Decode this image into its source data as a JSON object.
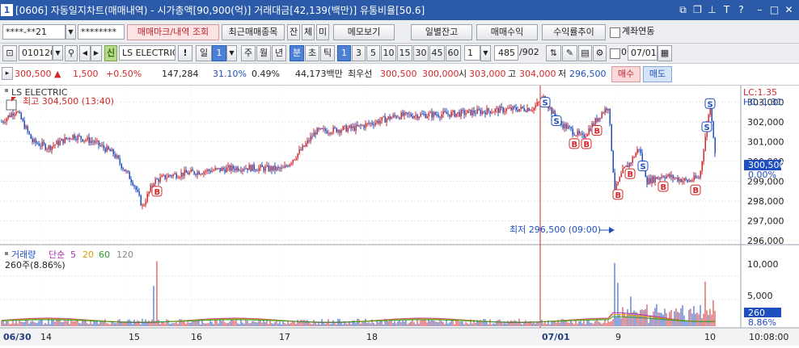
{
  "window": {
    "num": "1",
    "title": "[0606] 자동일지차트(매매내역) - 시가총액[90,900(억)] 거래대금[42,139(백만)] 유통비율[50.6]"
  },
  "toolbar1": {
    "account": "****-**21",
    "password": "********",
    "btn_trade_mark": "매매마크/내역 조회",
    "btn_recent": "최근매매종목",
    "btn_jan": "잔",
    "btn_che": "체",
    "btn_mi": "미",
    "btn_memo": "메모보기",
    "btn_daily": "일별잔고",
    "btn_profit": "매매수익",
    "btn_return": "수익률추이",
    "link_account": "계좌연동"
  },
  "toolbar2": {
    "code": "010120",
    "badge": "신",
    "name": "LS ELECTRIC",
    "excl": "!",
    "period_il": "일",
    "period_val": "1",
    "periods": [
      "주",
      "월",
      "년"
    ],
    "bun": "분",
    "cho": "초",
    "tik": "틱",
    "mins": [
      "1",
      "3",
      "5",
      "10",
      "15",
      "30",
      "45",
      "60"
    ],
    "count": "1",
    "total": "485",
    "total_max": "/902",
    "check_val": "0",
    "date": "07/01"
  },
  "quote": {
    "price": "300,500",
    "change": "1,500",
    "pct": "+0.50%",
    "volume": "147,284",
    "vol_pct": "31.10%",
    "rate": "0.49%",
    "amount": "44,173백만",
    "best_label": "최우선",
    "ask": "300,500",
    "bid": "300,000",
    "open_label": "시",
    "open": "303,000",
    "high_label": "고",
    "high": "304,000",
    "low_label": "저",
    "low": "296,500",
    "buy": "매수",
    "sell": "매도"
  },
  "price_chart": {
    "name": "LS ELECTRIC",
    "high_note": "최고 304,500 (13:40)",
    "low_note": "최저 296,500 (09:00)",
    "lc": "LC:1.35",
    "hc": "HC:-1.31",
    "current": "300,500",
    "current_pct": "0.00%",
    "y_labels": [
      "303,000",
      "302,000",
      "301,000",
      "300,000",
      "299,000",
      "298,000",
      "297,000",
      "296,000"
    ]
  },
  "volume_chart": {
    "title": "거래량",
    "ma_label": "단순",
    "ma": [
      "5",
      "20",
      "60",
      "120"
    ],
    "current": "260주(8.86%)",
    "y_labels": [
      "10,000",
      "5,000"
    ],
    "cur_val": "260",
    "cur_pct": "8.86%"
  },
  "x_axis": {
    "labels": [
      "06/30",
      "14",
      "15",
      "16",
      "17",
      "18",
      "07/01",
      "9",
      "10"
    ],
    "time": "10:08:00"
  },
  "colors": {
    "up": "#d62728",
    "down": "#1f4fbf",
    "accent": "#2b5aa8"
  },
  "chart_data": {
    "type": "candlestick",
    "x": [
      "06/30 14:00",
      "06/30 15:00",
      "06/30 16:00",
      "06/30 17:00",
      "06/30 18:00",
      "07/01 09:00",
      "07/01 10:00"
    ],
    "close_approx": [
      302000,
      298500,
      299300,
      300500,
      302400,
      301000,
      300500
    ],
    "price_range": [
      296000,
      303500
    ],
    "volume_range": [
      0,
      12000
    ]
  }
}
